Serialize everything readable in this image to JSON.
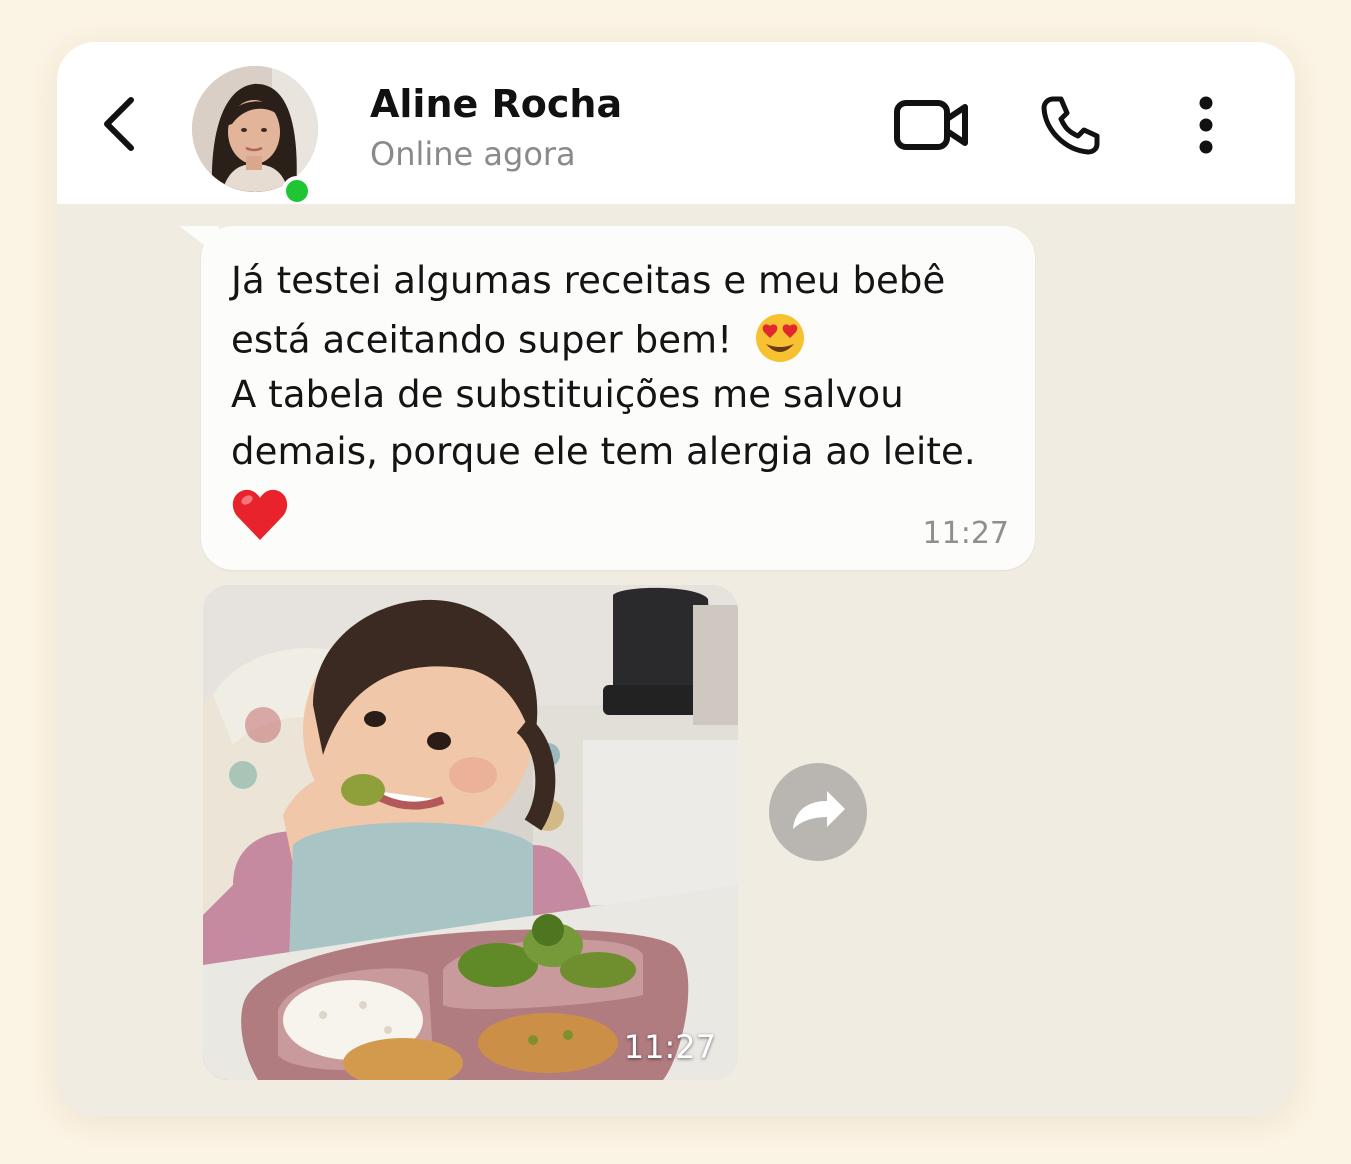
{
  "contact": {
    "name": "Aline Rocha",
    "status": "Online agora"
  },
  "header": {
    "icons": [
      "back-arrow-icon",
      "video-camera-icon",
      "phone-icon",
      "more-vertical-icon"
    ]
  },
  "messages": [
    {
      "type": "text",
      "lines": [
        "Já testei algumas receitas e meu bebê",
        "está aceitando super bem!",
        "A tabela de substituições me salvou",
        "demais, porque ele tem alergia ao leite."
      ],
      "emojis": [
        "heart-eyes-emoji",
        "red-heart-emoji"
      ],
      "time": "11:27"
    },
    {
      "type": "image",
      "description_icon": "photo-baby-eating",
      "time": "11:27"
    }
  ],
  "colors": {
    "page_bg": "#fbf3e3",
    "chat_bg": "#f1ece2",
    "online": "#1fc532",
    "bubble": "#fcfcfb"
  }
}
